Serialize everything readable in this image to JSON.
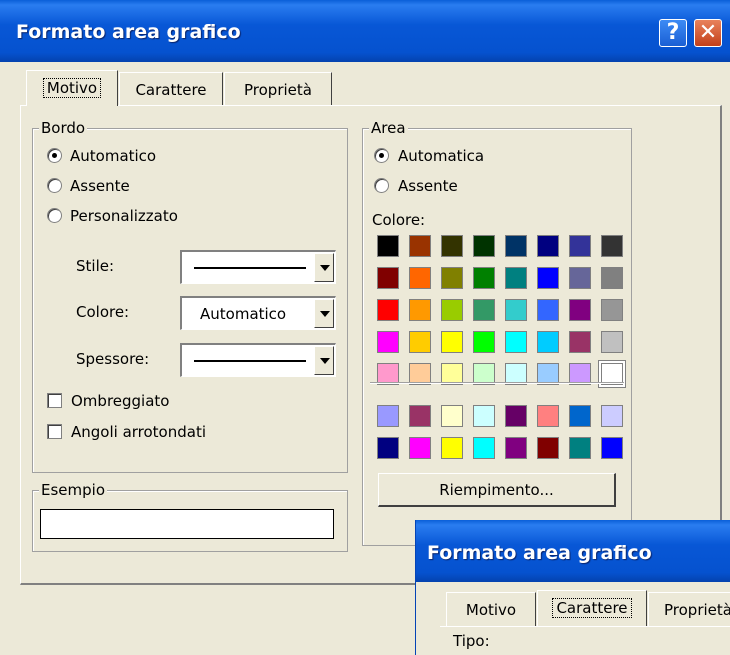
{
  "window": {
    "title": "Formato area grafico",
    "help_label": "?",
    "close_label": "✕"
  },
  "tabs": [
    {
      "label": "Motivo",
      "active": true
    },
    {
      "label": "Carattere",
      "active": false
    },
    {
      "label": "Proprietà",
      "active": false
    }
  ],
  "bordo": {
    "legend": "Bordo",
    "options": [
      {
        "label": "Automatico",
        "selected": true
      },
      {
        "label": "Assente",
        "selected": false
      },
      {
        "label": "Personalizzato",
        "selected": false
      }
    ],
    "stile_label": "Stile:",
    "colore_label": "Colore:",
    "colore_value": "Automatico",
    "spessore_label": "Spessore:",
    "ombreggiato_label": "Ombreggiato",
    "ombreggiato_checked": false,
    "angoli_label": "Angoli arrotondati",
    "angoli_checked": false
  },
  "esempio": {
    "legend": "Esempio"
  },
  "area": {
    "legend": "Area",
    "options": [
      {
        "label": "Automatica",
        "selected": true
      },
      {
        "label": "Assente",
        "selected": false
      }
    ],
    "colore_label": "Colore:",
    "palette": [
      [
        "#000000",
        "#993300",
        "#333300",
        "#003300",
        "#003366",
        "#000080",
        "#333399",
        "#333333"
      ],
      [
        "#800000",
        "#ff6600",
        "#808000",
        "#008000",
        "#008080",
        "#0000ff",
        "#666699",
        "#808080"
      ],
      [
        "#ff0000",
        "#ff9900",
        "#99cc00",
        "#339966",
        "#33cccc",
        "#3366ff",
        "#800080",
        "#969696"
      ],
      [
        "#ff00ff",
        "#ffcc00",
        "#ffff00",
        "#00ff00",
        "#00ffff",
        "#00ccff",
        "#993366",
        "#c0c0c0"
      ],
      [
        "#ff99cc",
        "#ffcc99",
        "#ffff99",
        "#ccffcc",
        "#ccffff",
        "#99ccff",
        "#cc99ff",
        "#ffffff"
      ]
    ],
    "palette_extra": [
      [
        "#9999ff",
        "#993366",
        "#ffffcc",
        "#ccffff",
        "#660066",
        "#ff8080",
        "#0066cc",
        "#ccccff"
      ],
      [
        "#000080",
        "#ff00ff",
        "#ffff00",
        "#00ffff",
        "#800080",
        "#800000",
        "#008080",
        "#0000ff"
      ]
    ],
    "selected_swatch": "#ffffff",
    "riempimento_label": "Riempimento..."
  },
  "second_dialog": {
    "title": "Formato area grafico",
    "tabs": [
      {
        "label": "Motivo",
        "active": false
      },
      {
        "label": "Carattere",
        "active": true
      },
      {
        "label": "Proprietà",
        "active": false
      }
    ],
    "tipo_label": "Tipo:"
  },
  "colors": {
    "titlebar": "#0552cf",
    "dialog_bg": "#ece9d8"
  }
}
